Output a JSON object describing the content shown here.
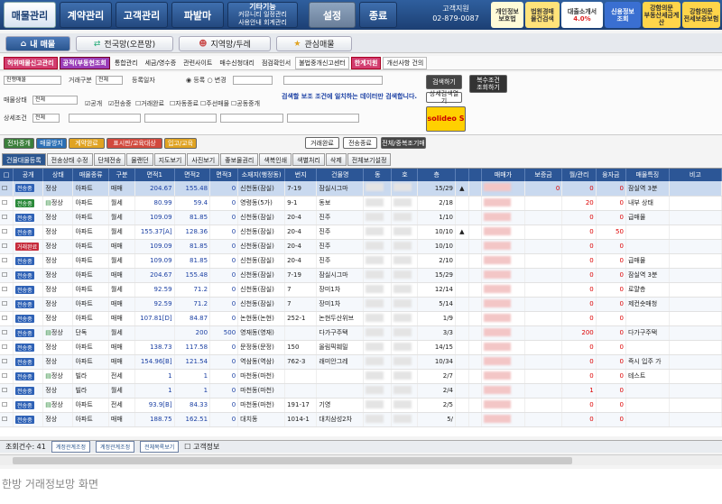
{
  "topnav": {
    "tabs": [
      "매물관리",
      "계약관리",
      "고객관리",
      "파발마"
    ],
    "etc_label": "기타기능",
    "etc_sub": [
      "커뮤니티",
      "일정관리",
      "사용안내",
      "회계관리"
    ],
    "settings_label": "설정",
    "exit_label": "종료",
    "customer_center": "고객지원",
    "phone": "02-879-0087",
    "promos": [
      {
        "line1": "개인정보",
        "line2": "보호법"
      },
      {
        "line1": "법원경매",
        "line2": "물건검색"
      },
      {
        "line1": "대출소개서",
        "line2": "4.0%"
      },
      {
        "line1": "신용정보",
        "line2": "조회"
      },
      {
        "line1": "강함의문",
        "line2": "부동산세금계산"
      },
      {
        "line1": "강함의문",
        "line2": "전세보증보험"
      }
    ]
  },
  "subnav": {
    "tabs": [
      {
        "label": "내 매물",
        "icon": "home-icon"
      },
      {
        "label": "전국망(오픈망)",
        "icon": "network-icon"
      },
      {
        "label": "지역망/두레",
        "icon": "people-icon"
      },
      {
        "label": "관심매물",
        "icon": "star-icon"
      }
    ]
  },
  "menubar": {
    "items": [
      "허위매물신고관리",
      "공적(부동현조회",
      "통합관리",
      "세금/영수증",
      "관련사이트",
      "매수신청대리",
      "점검확인서",
      "불법중개신고센터",
      "한계지원",
      "개선사항 건의"
    ]
  },
  "filters": {
    "row1": {
      "label1": "진행매물",
      "label2": "거래구분",
      "val2": "전체",
      "label3": "등록일자",
      "r1": "등록",
      "r2": "변경",
      "btn_search": "검색하기",
      "btn_multi": "복수조건\n조회하기"
    },
    "row2": {
      "label": "매물상태",
      "val": "전체",
      "note": "검색할 보조 조건에 일치하는 데이터만 검색합니다.",
      "btn_detail": "상세검색열기"
    },
    "row3": {
      "label": "상세조건",
      "val": "전체",
      "checks": [
        "공개",
        "전송중",
        "거래완료",
        "자동종료",
        "주선매물",
        "공동중개"
      ]
    },
    "ad": "solideo S"
  },
  "toolbar": {
    "colors": [
      {
        "label": "전자중개",
        "color": "#3a7f3a"
      },
      {
        "label": "매물방지",
        "color": "#2a6fb5"
      },
      {
        "label": "계약완료",
        "color": "#e0a322"
      },
      {
        "label": "표시판/교육대상",
        "color": "#d2493d"
      },
      {
        "label": "입고/교육",
        "color": "#e0a322"
      }
    ],
    "buttons": [
      "거래완료",
      "전송종료",
      "전체/중복조기매"
    ]
  },
  "grid_tabs": [
    "건물대물등록",
    "전송상태 수정",
    "단체전송",
    "물랜던",
    "지도보기",
    "사진보기",
    "좋보물권리",
    "색복인쇄",
    "색별처리",
    "삭제",
    "전체보기설정"
  ],
  "grid": {
    "headers": [
      "□",
      "공개",
      "상태",
      "매물종류",
      "구분",
      "면적1",
      "면적2",
      "면적3",
      "소재지(행정동)",
      "번지",
      "건물명",
      "동",
      "호",
      "층",
      "",
      "",
      "매매가",
      "보증금",
      "월/관리",
      "융자금",
      "매물특징",
      "비고"
    ],
    "rows": [
      {
        "badge": "전송중",
        "bc": "b",
        "status": "정상",
        "kind": "아파트",
        "deal": "매매",
        "a1": "204.67",
        "a2": "155.48",
        "a3": "0",
        "addr": "신천동(잠실)",
        "lot": "7-19",
        "bldg": "잠실시그마",
        "floor": "15/29",
        "mark": "▲",
        "sale": "",
        "dep": "0",
        "rent": "0",
        "loan": "0",
        "feat": "잠실역 3분",
        "selected": true
      },
      {
        "badge": "전송중",
        "bc": "g",
        "icon": true,
        "status": "정상",
        "kind": "아파트",
        "deal": "월세",
        "a1": "80.99",
        "a2": "59.4",
        "a3": "0",
        "addr": "영령동(5가)",
        "lot": "9-1",
        "bldg": "동보",
        "floor": "2/18",
        "mark": "",
        "sale": "",
        "dep": "",
        "rent": "20",
        "loan": "0",
        "feat": "내부 상태"
      },
      {
        "badge": "전송중",
        "bc": "b",
        "status": "정상",
        "kind": "아파트",
        "deal": "월세",
        "a1": "109.09",
        "a2": "81.85",
        "a3": "0",
        "addr": "신천동(잠실)",
        "lot": "20-4",
        "bldg": "진주",
        "floor": "1/10",
        "mark": "",
        "sale": "",
        "dep": "",
        "rent": "0",
        "loan": "0",
        "feat": "급매물"
      },
      {
        "badge": "전송중",
        "bc": "b",
        "status": "정상",
        "kind": "아파트",
        "deal": "월세",
        "a1": "155.37[A]",
        "a2": "128.36",
        "a3": "0",
        "addr": "신천동(잠실)",
        "lot": "20-4",
        "bldg": "진주",
        "floor": "10/10",
        "mark": "▲",
        "sale": "",
        "dep": "",
        "rent": "0",
        "loan": "50",
        "feat": ""
      },
      {
        "badge": "거래완료",
        "bc": "r",
        "status": "정상",
        "kind": "아파트",
        "deal": "매매",
        "a1": "109.09",
        "a2": "81.85",
        "a3": "0",
        "addr": "신천동(잠실)",
        "lot": "20-4",
        "bldg": "진주",
        "floor": "10/10",
        "mark": "",
        "sale": "",
        "dep": "",
        "rent": "0",
        "loan": "0",
        "feat": ""
      },
      {
        "badge": "전송중",
        "bc": "b",
        "status": "정상",
        "kind": "아파트",
        "deal": "월세",
        "a1": "109.09",
        "a2": "81.85",
        "a3": "0",
        "addr": "신천동(잠실)",
        "lot": "20-4",
        "bldg": "진주",
        "floor": "2/10",
        "mark": "",
        "sale": "",
        "dep": "",
        "rent": "0",
        "loan": "0",
        "feat": "급매물"
      },
      {
        "badge": "전송중",
        "bc": "b",
        "status": "정상",
        "kind": "아파트",
        "deal": "매매",
        "a1": "204.67",
        "a2": "155.48",
        "a3": "0",
        "addr": "신천동(잠실)",
        "lot": "7-19",
        "bldg": "잠실시그마",
        "floor": "15/29",
        "mark": "",
        "sale": "",
        "dep": "",
        "rent": "0",
        "loan": "0",
        "feat": "잠실역 3분"
      },
      {
        "badge": "전송중",
        "bc": "b",
        "status": "정상",
        "kind": "아파트",
        "deal": "월세",
        "a1": "92.59",
        "a2": "71.2",
        "a3": "0",
        "addr": "신천동(잠실)",
        "lot": "7",
        "bldg": "장미1차",
        "floor": "12/14",
        "mark": "",
        "sale": "",
        "dep": "",
        "rent": "0",
        "loan": "0",
        "feat": "로얄층"
      },
      {
        "badge": "전송중",
        "bc": "b",
        "status": "정상",
        "kind": "아파트",
        "deal": "매매",
        "a1": "92.59",
        "a2": "71.2",
        "a3": "0",
        "addr": "신천동(잠실)",
        "lot": "7",
        "bldg": "장미1차",
        "floor": "5/14",
        "mark": "",
        "sale": "",
        "dep": "",
        "rent": "0",
        "loan": "0",
        "feat": "제컨숏매청"
      },
      {
        "badge": "전송중",
        "bc": "b",
        "status": "정상",
        "kind": "아파트",
        "deal": "매매",
        "a1": "107.81[D]",
        "a2": "84.87",
        "a3": "0",
        "addr": "논현동(논현)",
        "lot": "252-1",
        "bldg": "논현두산위브",
        "floor": "1/9",
        "mark": "",
        "sale": "",
        "dep": "",
        "rent": "0",
        "loan": "0",
        "feat": ""
      },
      {
        "badge": "전송중",
        "bc": "b",
        "icon": true,
        "status": "정상",
        "kind": "단독",
        "deal": "월세",
        "a1": "",
        "a2": "200",
        "a3": "500",
        "addr": "영재동(영재)",
        "lot": "",
        "bldg": "다가구주택",
        "floor": "3/3",
        "mark": "",
        "sale": "",
        "dep": "",
        "rent": "200",
        "loan": "0",
        "feat": "다가구주택"
      },
      {
        "badge": "전송중",
        "bc": "b",
        "status": "정상",
        "kind": "아파트",
        "deal": "매매",
        "a1": "138.73",
        "a2": "117.58",
        "a3": "0",
        "addr": "문정동(문정)",
        "lot": "150",
        "bldg": "올림픽훼밀",
        "floor": "14/15",
        "mark": "",
        "sale": "",
        "dep": "",
        "rent": "0",
        "loan": "0",
        "feat": ""
      },
      {
        "badge": "전송중",
        "bc": "b",
        "status": "정상",
        "kind": "아파트",
        "deal": "매매",
        "a1": "154.96[B]",
        "a2": "121.54",
        "a3": "0",
        "addr": "역삼동(역삼)",
        "lot": "762-3",
        "bldg": "래미안그레",
        "floor": "10/34",
        "mark": "",
        "sale": "",
        "dep": "",
        "rent": "0",
        "loan": "0",
        "feat": "즉시 입주 가"
      },
      {
        "badge": "전송중",
        "bc": "b",
        "icon": true,
        "status": "정상",
        "kind": "빌라",
        "deal": "전세",
        "a1": "1",
        "a2": "1",
        "a3": "0",
        "addr": "마천동(마천)",
        "lot": "",
        "bldg": "",
        "floor": "2/7",
        "mark": "",
        "sale": "",
        "dep": "",
        "rent": "0",
        "loan": "0",
        "feat": "테스트"
      },
      {
        "badge": "전송중",
        "bc": "b",
        "status": "정상",
        "kind": "빌라",
        "deal": "월세",
        "a1": "1",
        "a2": "1",
        "a3": "0",
        "addr": "마천동(마천)",
        "lot": "",
        "bldg": "",
        "floor": "2/4",
        "mark": "",
        "sale": "",
        "dep": "",
        "rent": "1",
        "loan": "0",
        "feat": ""
      },
      {
        "badge": "전송중",
        "bc": "b",
        "icon": true,
        "status": "정상",
        "kind": "아파트",
        "deal": "전세",
        "a1": "93.9[B]",
        "a2": "84.33",
        "a3": "0",
        "addr": "마천동(마천)",
        "lot": "191-17",
        "bldg": "기영",
        "floor": "2/5",
        "mark": "",
        "sale": "",
        "dep": "",
        "rent": "0",
        "loan": "0",
        "feat": ""
      },
      {
        "badge": "전송중",
        "bc": "b",
        "status": "정상",
        "kind": "아파트",
        "deal": "매매",
        "a1": "188.75",
        "a2": "162.51",
        "a3": "0",
        "addr": "대치동",
        "lot": "1014-1",
        "bldg": "대치삼성2차",
        "floor": "5/",
        "mark": "",
        "sale": "",
        "dep": "",
        "rent": "0",
        "loan": "0",
        "feat": ""
      }
    ]
  },
  "status": {
    "count_label": "조회건수: 41",
    "buttons": [
      "계정관계조정",
      "계정관계조정",
      "전체목록보기"
    ],
    "checkbox_label": "고객정보"
  },
  "caption": "한방 거래정보망 화면"
}
